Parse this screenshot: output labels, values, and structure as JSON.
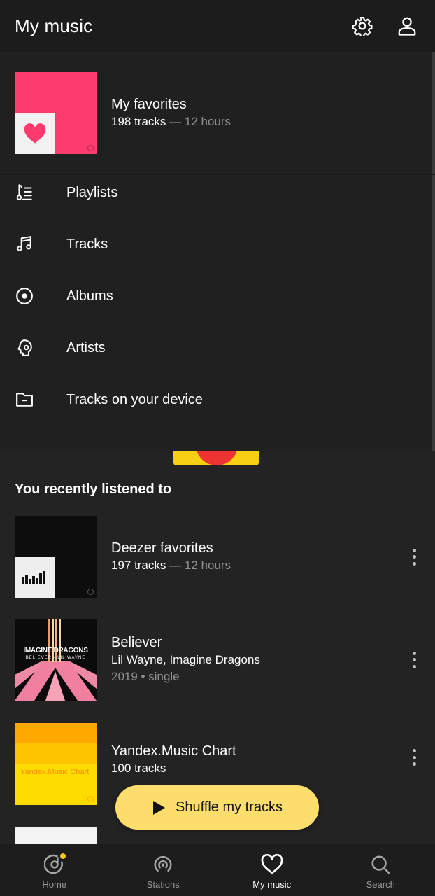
{
  "header": {
    "title": "My music",
    "settings_icon": "gear-icon",
    "profile_icon": "user-icon"
  },
  "favorites": {
    "title": "My favorites",
    "tracks": "198 tracks",
    "duration": "— 12 hours",
    "cover_color": "#fc3a6e"
  },
  "menu": {
    "items": [
      {
        "label": "Playlists",
        "icon": "playlist-icon"
      },
      {
        "label": "Tracks",
        "icon": "music-note-icon"
      },
      {
        "label": "Albums",
        "icon": "album-icon"
      },
      {
        "label": "Artists",
        "icon": "artist-icon"
      },
      {
        "label": "Tracks on your device",
        "icon": "folder-icon"
      }
    ]
  },
  "recent": {
    "heading": "You recently listened to",
    "items": [
      {
        "title": "Deezer favorites",
        "tracks": "197 tracks",
        "duration": "— 12 hours"
      },
      {
        "title": "Believer",
        "artists": "Lil Wayne, Imagine Dragons",
        "meta": "2019 • single",
        "cover_text": "IMAGINE DRAGONS",
        "cover_subtext": "BELIEVER · LIL WAYNE"
      },
      {
        "title": "Yandex.Music Chart",
        "tracks": "100 tracks",
        "cover_text": "Yandex.Music Chart"
      }
    ]
  },
  "shuffle": {
    "label": "Shuffle my tracks",
    "color": "#fddd6c"
  },
  "bottom_nav": {
    "items": [
      {
        "label": "Home",
        "icon": "home-icon"
      },
      {
        "label": "Stations",
        "icon": "radio-icon"
      },
      {
        "label": "My music",
        "icon": "heart-icon",
        "active": true
      },
      {
        "label": "Search",
        "icon": "search-icon"
      }
    ]
  }
}
